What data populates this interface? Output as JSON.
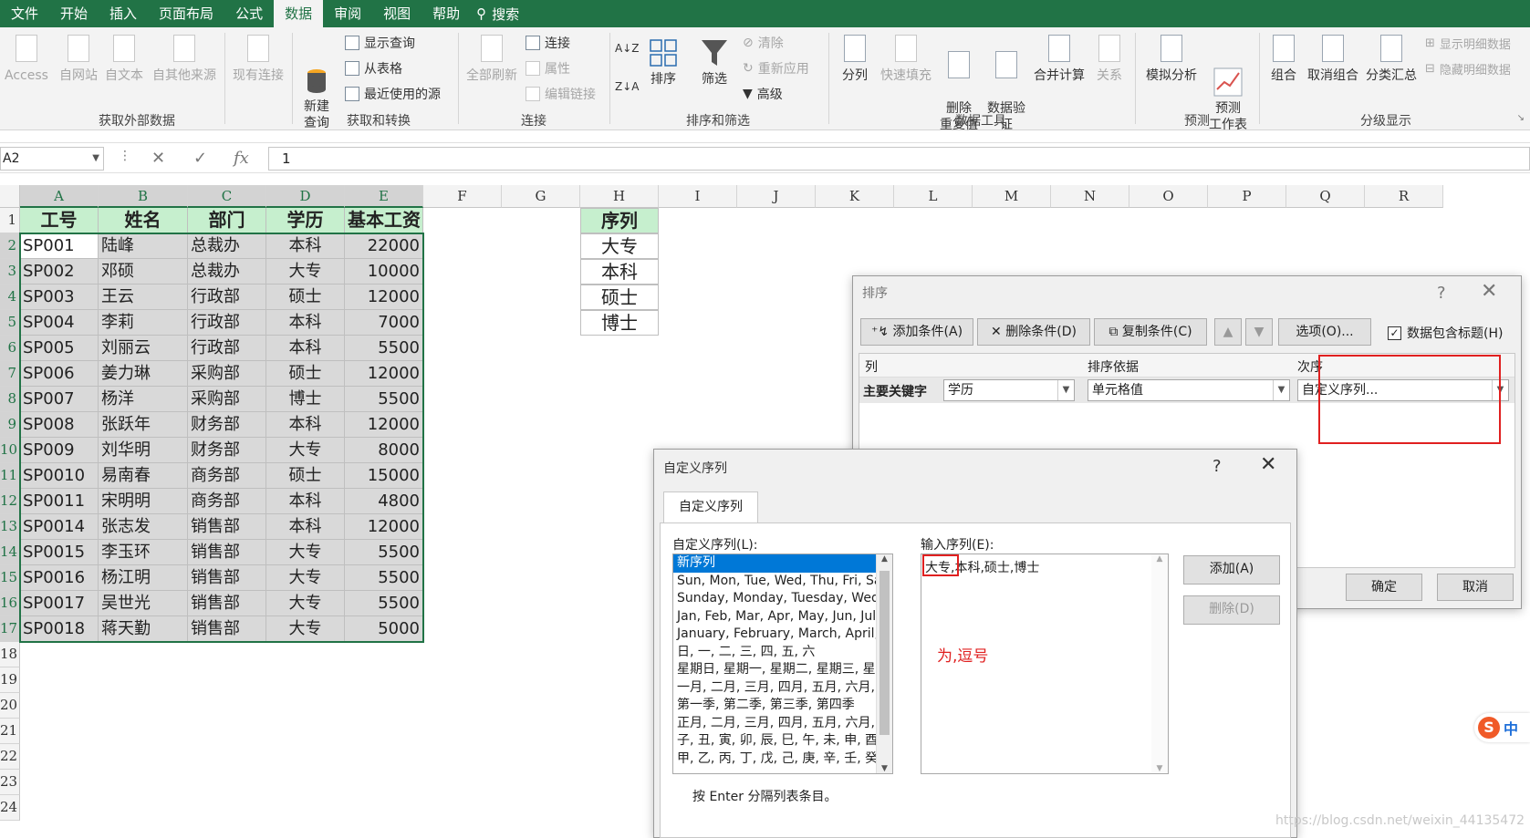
{
  "tabs": [
    "文件",
    "开始",
    "插入",
    "页面布局",
    "公式",
    "数据",
    "审阅",
    "视图",
    "帮助"
  ],
  "active_tab": "数据",
  "search_label": "搜索",
  "ribbon": {
    "access": "Access",
    "from_web": "自网站",
    "from_text": "自文本",
    "from_other": "自其他来源",
    "existing_conn": "现有连接",
    "new_query": "新建\n查询",
    "show_query": "显示查询",
    "from_table": "从表格",
    "recent_sources": "最近使用的源",
    "refresh_all": "全部刷新",
    "connections": "连接",
    "properties": "属性",
    "edit_links": "编辑链接",
    "sort": "排序",
    "filter": "筛选",
    "clear": "清除",
    "reapply": "重新应用",
    "advanced": "高级",
    "text_to_cols": "分列",
    "flash_fill": "快速填充",
    "remove_dups": "删除\n重复值",
    "data_validation": "数据验\n证",
    "consolidate": "合并计算",
    "relationships": "关系",
    "whatif": "模拟分析",
    "forecast_sheet": "预测\n工作表",
    "group": "组合",
    "ungroup": "取消组合",
    "subtotal": "分类汇总",
    "show_detail": "显示明细数据",
    "hide_detail": "隐藏明细数据",
    "groups": [
      "获取外部数据",
      "获取和转换",
      "连接",
      "排序和筛选",
      "数据工具",
      "预测",
      "分级显示"
    ]
  },
  "formula_bar": {
    "name_box": "A2",
    "fx": "fx",
    "value": "1"
  },
  "columns": [
    "A",
    "B",
    "C",
    "D",
    "E",
    "F",
    "G",
    "H",
    "I",
    "J",
    "K",
    "L",
    "M",
    "N",
    "O",
    "P",
    "Q",
    "R"
  ],
  "rows": [
    "1",
    "2",
    "3",
    "4",
    "5",
    "6",
    "7",
    "8",
    "9",
    "10",
    "11",
    "12",
    "13",
    "14",
    "15",
    "16",
    "17",
    "18",
    "19",
    "20",
    "21",
    "22",
    "23",
    "24"
  ],
  "table": {
    "headers": [
      "工号",
      "姓名",
      "部门",
      "学历",
      "基本工资"
    ],
    "rows": [
      [
        "SP001",
        "陆峰",
        "总裁办",
        "本科",
        "22000"
      ],
      [
        "SP002",
        "邓硕",
        "总裁办",
        "大专",
        "10000"
      ],
      [
        "SP003",
        "王云",
        "行政部",
        "硕士",
        "12000"
      ],
      [
        "SP004",
        "李莉",
        "行政部",
        "本科",
        "7000"
      ],
      [
        "SP005",
        "刘丽云",
        "行政部",
        "本科",
        "5500"
      ],
      [
        "SP006",
        "姜力琳",
        "采购部",
        "硕士",
        "12000"
      ],
      [
        "SP007",
        "杨洋",
        "采购部",
        "博士",
        "5500"
      ],
      [
        "SP008",
        "张跃年",
        "财务部",
        "本科",
        "12000"
      ],
      [
        "SP009",
        "刘华明",
        "财务部",
        "大专",
        "8000"
      ],
      [
        "SP0010",
        "易南春",
        "商务部",
        "硕士",
        "15000"
      ],
      [
        "SP0011",
        "宋明明",
        "商务部",
        "本科",
        "4800"
      ],
      [
        "SP0014",
        "张志发",
        "销售部",
        "本科",
        "12000"
      ],
      [
        "SP0015",
        "李玉环",
        "销售部",
        "大专",
        "5500"
      ],
      [
        "SP0016",
        "杨江明",
        "销售部",
        "大专",
        "5500"
      ],
      [
        "SP0017",
        "吴世光",
        "销售部",
        "大专",
        "5500"
      ],
      [
        "SP0018",
        "蒋天勤",
        "销售部",
        "大专",
        "5000"
      ]
    ]
  },
  "sequence": {
    "header": "序列",
    "items": [
      "大专",
      "本科",
      "硕士",
      "博士"
    ]
  },
  "sort_dialog": {
    "title": "排序",
    "help": "?",
    "add_level": "添加条件(A)",
    "delete_level": "删除条件(D)",
    "copy_level": "复制条件(C)",
    "options": "选项(O)...",
    "has_headers": "数据包含标题(H)",
    "col_header": "列",
    "sort_on_header": "排序依据",
    "order_header": "次序",
    "row_label": "主要关键字",
    "column_value": "学历",
    "sort_on_value": "单元格值",
    "order_value": "自定义序列...",
    "ok": "确定",
    "cancel": "取消"
  },
  "custom_dialog": {
    "title": "自定义序列",
    "help": "?",
    "tab": "自定义序列",
    "list_label": "自定义序列(L):",
    "entries_label": "输入序列(E):",
    "lists": [
      "新序列",
      "Sun, Mon, Tue, Wed, Thu, Fri, Sa",
      "Sunday, Monday, Tuesday, Wedi",
      "Jan, Feb, Mar, Apr, May, Jun, Jul,",
      "January, February, March, April, I",
      "日, 一, 二, 三, 四, 五, 六",
      "星期日, 星期一, 星期二, 星期三, 星期",
      "一月, 二月, 三月, 四月, 五月, 六月, 一",
      "第一季, 第二季, 第三季, 第四季",
      "正月, 二月, 三月, 四月, 五月, 六月, 一",
      "子, 丑, 寅, 卯, 辰, 巳, 午, 未, 申, 酉, ",
      "甲, 乙, 丙, 丁, 戊, 己, 庚, 辛, 壬, 癸"
    ],
    "entries": "大专,本科,硕士,博士",
    "annotation": "为,逗号",
    "add": "添加(A)",
    "delete": "删除(D)",
    "hint": "按 Enter 分隔列表条目。"
  },
  "watermark": "https://blog.csdn.net/weixin_44135472",
  "ime_label": "中",
  "colors": {
    "excel_green": "#217346",
    "header_fill": "#c6efce",
    "data_fill": "#d9d9d9",
    "annotation_red": "#e02020"
  }
}
